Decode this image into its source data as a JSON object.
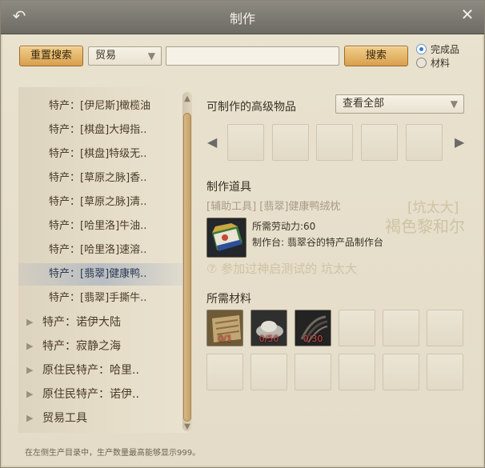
{
  "window": {
    "title": "制作"
  },
  "toolbar": {
    "reset_label": "重置搜索",
    "category_value": "贸易",
    "search_value": "",
    "search_label": "搜索",
    "radio_finished": "完成品",
    "radio_material": "材料",
    "selected_radio": "完成品"
  },
  "tree": {
    "children": [
      "特产：[伊尼斯]橄榄油",
      "特产：[棋盘]大拇指..",
      "特产：[棋盘]特级无..",
      "特产：[草原之脉]香..",
      "特产：[草原之脉]清..",
      "特产：[哈里洛]牛油..",
      "特产：[哈里洛]速溶..",
      "特产：[翡翠]健康鸭..",
      "特产：[翡翠]手撕牛.."
    ],
    "parents": [
      "特产：诺伊大陆",
      "特产：寂静之海",
      "原住民特产：哈里..",
      "原住民特产：诺伊..",
      "贸易工具"
    ],
    "selected_index": 7
  },
  "advanced": {
    "label": "可制作的高级物品",
    "filter_value": "查看全部"
  },
  "tool": {
    "label": "制作道具",
    "item_name": "[辅助工具] [翡翠]健康鸭绒枕",
    "labor": "所需劳动力:60",
    "station": "制作台: 翡翠谷的特产品制作台"
  },
  "materials": {
    "label": "所需材料",
    "counts": [
      "0/1",
      "0/50",
      "0/30"
    ]
  },
  "ghost_text": {
    "line1": "[坑太大]",
    "line2": "褐色黎和尔",
    "line3": "参加过神启测试的 坑太大"
  },
  "footer": "在左侧生产目录中，生产数量最高能够显示999。",
  "colors": {
    "accent_button": "#d89f4d",
    "selected_row": "#a8b4c8",
    "material_count": "#e04a40"
  },
  "icons": {
    "back": "back-arrow-icon",
    "close": "close-icon"
  }
}
